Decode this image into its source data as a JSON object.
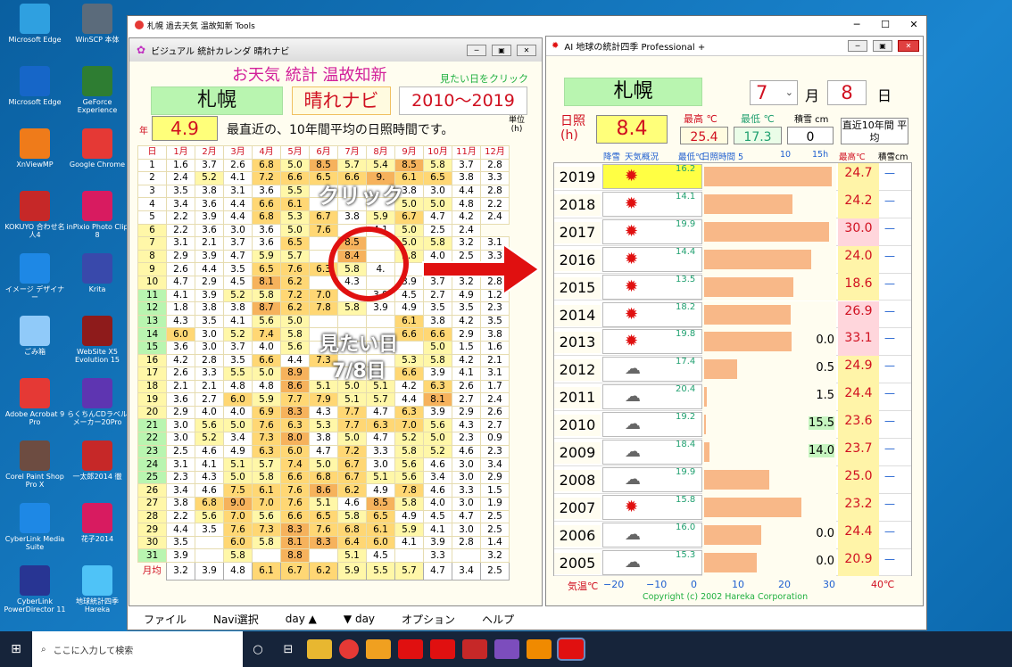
{
  "desktop": [
    {
      "label": "Microsoft Edge",
      "color": "#2fa0e0"
    },
    {
      "label": "WinSCP 本体",
      "color": "#5b6b7b"
    },
    {
      "label": "Microsoft Edge",
      "color": "#1666c8"
    },
    {
      "label": "GeForce Experience",
      "color": "#2e7d32"
    },
    {
      "label": "XnViewMP",
      "color": "#ef7b1a"
    },
    {
      "label": "Google Chrome",
      "color": "#e53935"
    },
    {
      "label": "KOKUYO 合わせ名人4",
      "color": "#c62828"
    },
    {
      "label": "inPixio Photo Clip 8",
      "color": "#d81b60"
    },
    {
      "label": "イメージ デザイナー",
      "color": "#1e88e5"
    },
    {
      "label": "Krita",
      "color": "#3949ab"
    },
    {
      "label": "ごみ箱",
      "color": "#90caf9"
    },
    {
      "label": "WebSite X5 Evolution 15",
      "color": "#8e1b1b"
    },
    {
      "label": "Adobe Acrobat 9 Pro",
      "color": "#e53935"
    },
    {
      "label": "らくちんCDラベルメーカー20Pro",
      "color": "#5e35b1"
    },
    {
      "label": "Corel Paint Shop Pro X",
      "color": "#6d4c41"
    },
    {
      "label": "一太郎2014 徹",
      "color": "#c62828"
    },
    {
      "label": "CyberLink Media Suite",
      "color": "#1e88e5"
    },
    {
      "label": "花子2014",
      "color": "#d81b60"
    },
    {
      "label": "CyberLink PowerDirector 11",
      "color": "#283593"
    },
    {
      "label": "地球統計四季 Hareka",
      "color": "#4fc3f7"
    }
  ],
  "outer_title": "札幌 過去天気 温故知新 Tools",
  "left": {
    "title": "ビジュアル 統計カレンダ 晴れナビ",
    "heading": "お天気 統計 温故知新",
    "hint": "見たい日をクリック",
    "city": "札幌",
    "navi": "晴れナビ",
    "years": "2010～2019",
    "year_side": "年",
    "value": "4.9",
    "desc": "最直近の、10年間平均の日照時間です。",
    "unit": "単位 (h)",
    "col_day": "日",
    "months": [
      "1月",
      "2月",
      "3月",
      "4月",
      "5月",
      "6月",
      "7月",
      "8月",
      "9月",
      "10月",
      "11月",
      "12月"
    ],
    "rows": [
      [
        "1",
        "1.6",
        "3.7",
        "2.6",
        "6.8",
        "5.0",
        "8.5",
        "5.7",
        "5.4",
        "8.5",
        "5.8",
        "3.7",
        "2.8"
      ],
      [
        "2",
        "2.4",
        "5.2",
        "4.1",
        "7.2",
        "6.6",
        "6.5",
        "6.6",
        "9.",
        "6.1",
        "6.5",
        "3.8",
        "3.3"
      ],
      [
        "3",
        "3.5",
        "3.8",
        "3.1",
        "3.6",
        "5.5",
        "",
        "",
        "",
        "3.8",
        "3.0",
        "4.4",
        "2.8"
      ],
      [
        "4",
        "3.4",
        "3.6",
        "4.4",
        "6.6",
        "6.1",
        "",
        "",
        "",
        "5.0",
        "5.0",
        "4.8",
        "2.2"
      ],
      [
        "5",
        "2.2",
        "3.9",
        "4.4",
        "6.8",
        "5.3",
        "6.7",
        "3.8",
        "5.9",
        "6.7",
        "4.7",
        "4.2",
        "2.4"
      ],
      [
        "6",
        "2.2",
        "3.6",
        "3.0",
        "3.6",
        "5.0",
        "7.6",
        "",
        "4.1",
        "5.0",
        "2.5",
        "2.4"
      ],
      [
        "7",
        "3.1",
        "2.1",
        "3.7",
        "3.6",
        "6.5",
        "",
        "8.5",
        "",
        "5.0",
        "5.8",
        "3.2",
        "3.1"
      ],
      [
        "8",
        "2.9",
        "3.9",
        "4.7",
        "5.9",
        "5.7",
        "",
        "8.4",
        "",
        "5.8",
        "4.0",
        "2.5",
        "3.3"
      ],
      [
        "9",
        "2.6",
        "4.4",
        "3.5",
        "6.5",
        "7.6",
        "6.3",
        "5.8",
        "4.",
        "",
        "",
        "",
        ""
      ],
      [
        "10",
        "4.7",
        "2.9",
        "4.5",
        "8.1",
        "6.2",
        "",
        "4.3",
        "",
        "3.9",
        "3.7",
        "3.2",
        "2.8"
      ],
      [
        "11",
        "4.1",
        "3.9",
        "5.2",
        "5.8",
        "7.2",
        "7.0",
        "",
        "3.9",
        "4.5",
        "2.7",
        "4.9",
        "1.2"
      ],
      [
        "12",
        "1.8",
        "3.8",
        "3.8",
        "8.7",
        "6.2",
        "7.8",
        "5.8",
        "3.9",
        "4.9",
        "3.5",
        "3.5",
        "2.3"
      ],
      [
        "13",
        "4.3",
        "3.5",
        "4.1",
        "5.6",
        "5.0",
        "",
        "",
        "",
        "6.1",
        "3.8",
        "4.2",
        "3.5"
      ],
      [
        "14",
        "6.0",
        "3.0",
        "5.2",
        "7.4",
        "5.8",
        "",
        "",
        "",
        "6.6",
        "6.6",
        "2.9",
        "3.8"
      ],
      [
        "15",
        "3.6",
        "3.0",
        "3.7",
        "4.0",
        "5.6",
        "",
        "",
        "",
        "",
        "5.0",
        "1.5",
        "1.6"
      ],
      [
        "16",
        "4.2",
        "2.8",
        "3.5",
        "6.6",
        "4.4",
        "7.3",
        "",
        "",
        "5.3",
        "5.8",
        "4.2",
        "2.1"
      ],
      [
        "17",
        "2.6",
        "3.3",
        "5.5",
        "5.0",
        "8.9",
        "",
        "",
        "",
        "6.6",
        "3.9",
        "4.1",
        "3.1"
      ],
      [
        "18",
        "2.1",
        "2.1",
        "4.8",
        "4.8",
        "8.6",
        "5.1",
        "5.0",
        "5.1",
        "4.2",
        "6.3",
        "2.6",
        "1.7"
      ],
      [
        "19",
        "3.6",
        "2.7",
        "6.0",
        "5.9",
        "7.7",
        "7.9",
        "5.1",
        "5.7",
        "4.4",
        "8.1",
        "2.7",
        "2.4"
      ],
      [
        "20",
        "2.9",
        "4.0",
        "4.0",
        "6.9",
        "8.3",
        "4.3",
        "7.7",
        "4.7",
        "6.3",
        "3.9",
        "2.9",
        "2.6"
      ],
      [
        "21",
        "3.0",
        "5.6",
        "5.0",
        "7.6",
        "6.3",
        "5.3",
        "7.7",
        "6.3",
        "7.0",
        "5.6",
        "4.3",
        "2.7"
      ],
      [
        "22",
        "3.0",
        "5.2",
        "3.4",
        "7.3",
        "8.0",
        "3.8",
        "5.0",
        "4.7",
        "5.2",
        "5.0",
        "2.3",
        "0.9"
      ],
      [
        "23",
        "2.5",
        "4.6",
        "4.9",
        "6.3",
        "6.0",
        "4.7",
        "7.2",
        "3.3",
        "5.8",
        "5.2",
        "4.6",
        "2.3"
      ],
      [
        "24",
        "3.1",
        "4.1",
        "5.1",
        "5.7",
        "7.4",
        "5.0",
        "6.7",
        "3.0",
        "5.6",
        "4.6",
        "3.0",
        "3.4"
      ],
      [
        "25",
        "2.3",
        "4.3",
        "5.0",
        "5.8",
        "6.6",
        "6.8",
        "6.7",
        "5.1",
        "5.6",
        "3.4",
        "3.0",
        "2.9"
      ],
      [
        "26",
        "3.4",
        "4.6",
        "7.5",
        "6.1",
        "7.6",
        "8.6",
        "6.2",
        "4.9",
        "7.8",
        "4.6",
        "3.3",
        "1.5"
      ],
      [
        "27",
        "3.8",
        "6.8",
        "9.0",
        "7.0",
        "7.6",
        "5.1",
        "4.6",
        "8.5",
        "5.8",
        "4.0",
        "3.0",
        "1.9"
      ],
      [
        "28",
        "2.2",
        "5.6",
        "7.0",
        "5.6",
        "6.6",
        "6.5",
        "5.8",
        "6.5",
        "4.9",
        "4.5",
        "4.7",
        "2.5"
      ],
      [
        "29",
        "4.4",
        "3.5",
        "7.6",
        "7.3",
        "8.3",
        "7.6",
        "6.8",
        "6.1",
        "5.9",
        "4.1",
        "3.0",
        "2.5"
      ],
      [
        "30",
        "3.5",
        "",
        "6.0",
        "5.8",
        "8.1",
        "8.3",
        "6.4",
        "6.0",
        "4.1",
        "3.9",
        "2.8",
        "1.4"
      ],
      [
        "31",
        "3.9",
        "",
        "5.8",
        "",
        "8.8",
        "",
        "5.1",
        "4.5",
        "",
        "3.3",
        "",
        "3.2"
      ]
    ],
    "avg_label": "月均",
    "avg": [
      "3.2",
      "3.9",
      "4.8",
      "6.1",
      "6.7",
      "6.2",
      "5.9",
      "5.5",
      "5.7",
      "4.7",
      "3.4",
      "2.5"
    ]
  },
  "annot": {
    "click": "クリック",
    "target1": "見たい日",
    "target2": "7/8日"
  },
  "right": {
    "title": "AI 地球の統計四季 Professional +",
    "city": "札幌",
    "month": "7",
    "month_unit": "月",
    "day": "8",
    "day_unit": "日",
    "sun_label": "日照 (h)",
    "sun_value": "8.4",
    "max_label": "最高 ℃",
    "max_value": "25.4",
    "min_label": "最低 ℃",
    "min_value": "17.3",
    "snow_label": "積雪 cm",
    "snow_value": "0",
    "recent": "直近10年間 平均",
    "col_headers": [
      "降雪",
      "天気概況",
      "最低℃",
      "日照時間 5",
      "10",
      "15h",
      "最高℃",
      "積雪cm"
    ],
    "years": [
      {
        "y": "2019",
        "min": "16.2",
        "sun": 14.5,
        "rain": "",
        "max": "24.7",
        "snow": "—",
        "hi": false
      },
      {
        "y": "2018",
        "min": "14.1",
        "sun": 10,
        "rain": "",
        "max": "24.2",
        "snow": "—",
        "hi": false
      },
      {
        "y": "2017",
        "min": "19.9",
        "sun": 14.2,
        "rain": "",
        "max": "30.0",
        "snow": "—",
        "hi": true
      },
      {
        "y": "2016",
        "min": "14.4",
        "sun": 12.2,
        "rain": "",
        "max": "24.0",
        "snow": "—",
        "hi": false
      },
      {
        "y": "2015",
        "min": "13.5",
        "sun": 10.1,
        "rain": "",
        "max": "18.6",
        "snow": "—",
        "hi": false
      },
      {
        "y": "2014",
        "min": "18.2",
        "sun": 9.8,
        "rain": "",
        "max": "26.9",
        "snow": "—",
        "hi": true
      },
      {
        "y": "2013",
        "min": "19.8",
        "sun": 9.9,
        "rain": "0.0",
        "max": "33.1",
        "snow": "—",
        "hi": true
      },
      {
        "y": "2012",
        "min": "17.4",
        "sun": 3.8,
        "rain": "0.5",
        "max": "24.9",
        "snow": "—",
        "hi": false
      },
      {
        "y": "2011",
        "min": "20.4",
        "sun": 0.3,
        "rain": "1.5",
        "max": "24.4",
        "snow": "—",
        "hi": false
      },
      {
        "y": "2010",
        "min": "19.2",
        "sun": 0.2,
        "rain": "15.5",
        "max": "23.6",
        "snow": "—",
        "hi": false
      },
      {
        "y": "2009",
        "min": "18.4",
        "sun": 0.6,
        "rain": "14.0",
        "max": "23.7",
        "snow": "—",
        "hi": false
      },
      {
        "y": "2008",
        "min": "19.9",
        "sun": 7.4,
        "rain": "",
        "max": "25.0",
        "snow": "—",
        "hi": false
      },
      {
        "y": "2007",
        "min": "15.8",
        "sun": 11.0,
        "rain": "",
        "max": "23.2",
        "snow": "—",
        "hi": false
      },
      {
        "y": "2006",
        "min": "16.0",
        "sun": 6.5,
        "rain": "0.0",
        "max": "24.4",
        "snow": "—",
        "hi": false
      },
      {
        "y": "2005",
        "min": "15.3",
        "sun": 6.0,
        "rain": "0.0",
        "max": "20.9",
        "snow": "—",
        "hi": false
      }
    ],
    "axis_label": "気温℃",
    "axis_ticks": [
      "−20",
      "−10",
      "0",
      "10",
      "20",
      "30",
      "40℃"
    ],
    "copyright": "Copyright (c) 2002 Hareka Corporation"
  },
  "menu": [
    "ファイル",
    "Navi選択",
    "day ▲",
    "▼ day",
    "オプション",
    "ヘルプ"
  ],
  "taskbar": {
    "search": "ここに入力して検索"
  },
  "colors": {
    "accent": "#d01020",
    "green": "#b9f5b0",
    "yellow": "#ffff7a",
    "sunbar": "#f8b888"
  }
}
